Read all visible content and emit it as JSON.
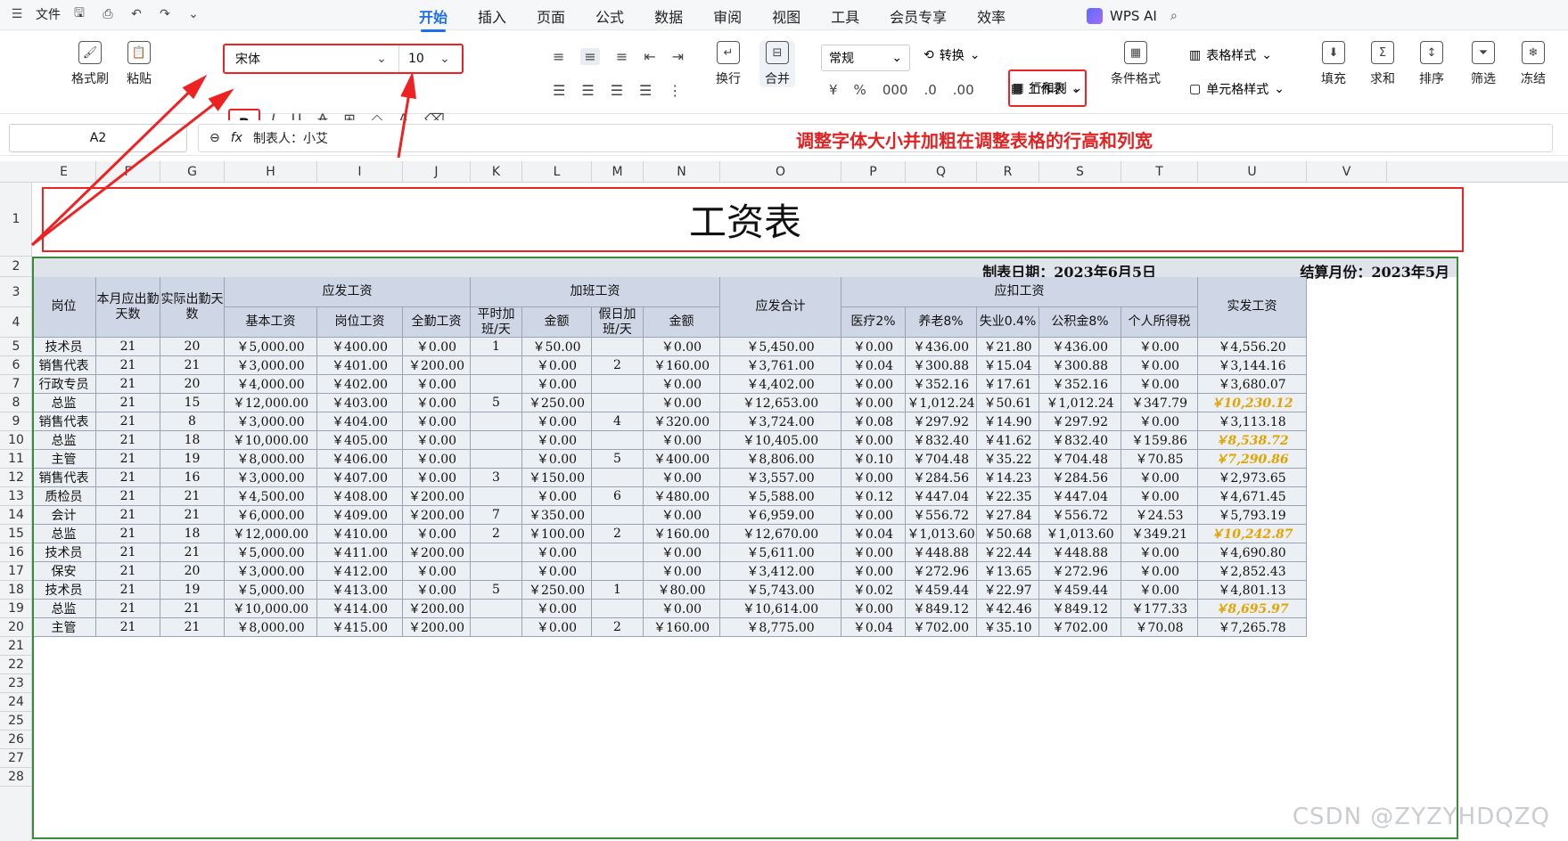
{
  "app": {
    "file_menu": "文件",
    "tabs": [
      "开始",
      "插入",
      "页面",
      "公式",
      "数据",
      "审阅",
      "视图",
      "工具",
      "会员专享",
      "效率"
    ],
    "active_tab": "开始",
    "wps_ai": "WPS AI"
  },
  "ribbon": {
    "format_painter": "格式刷",
    "paste": "粘贴",
    "font_name": "宋体",
    "font_size": "10",
    "wrap": "换行",
    "merge": "合并",
    "number_format": "常规",
    "convert": "转换",
    "row_col": "行和列",
    "table_style": "表格样式",
    "worksheet": "工作表",
    "cond_format": "条件格式",
    "cell_style": "单元格样式",
    "fill": "填充",
    "sum": "求和",
    "sort": "排序",
    "filter": "筛选",
    "freeze": "冻结"
  },
  "formula_bar": {
    "name_box": "A2",
    "fx": "fx",
    "content": "制表人：小艾"
  },
  "annotation": "调整字体大小并加粗在调整表格的行高和列宽",
  "sheet": {
    "columns": [
      "E",
      "F",
      "G",
      "H",
      "I",
      "J",
      "K",
      "L",
      "M",
      "N",
      "O",
      "P",
      "Q",
      "R",
      "S",
      "T",
      "U",
      "V"
    ],
    "rows": [
      "1",
      "2",
      "3",
      "4",
      "5",
      "6",
      "7",
      "8",
      "9",
      "10",
      "11",
      "12",
      "13",
      "14",
      "15",
      "16",
      "17",
      "18",
      "19",
      "20",
      "21",
      "22",
      "23",
      "24",
      "25",
      "26",
      "27",
      "28"
    ],
    "title": "工资表",
    "date_left": "制表日期：2023年6月5日",
    "date_right": "结算月份：2023年5月",
    "headers": {
      "post": "岗位",
      "due_days": "本月应出勤天数",
      "actual_days": "实际出勤天数",
      "payable": "应发工资",
      "base": "基本工资",
      "post_pay": "岗位工资",
      "attendance_pay": "全勤工资",
      "overtime": "加班工资",
      "weekday_ot": "平时加班/天",
      "amount1": "金额",
      "holiday_ot": "假日加班/天",
      "amount2": "金额",
      "total_payable": "应发合计",
      "deductions": "应扣工资",
      "medical": "医疗2%",
      "pension": "养老8%",
      "unemployment": "失业0.4%",
      "housing": "公积金8%",
      "tax": "个人所得税",
      "net": "实发工资"
    },
    "data": [
      [
        "技术员",
        "21",
        "20",
        "￥5,000.00",
        "￥400.00",
        "￥0.00",
        "1",
        "￥50.00",
        "",
        "￥0.00",
        "￥5,450.00",
        "￥0.00",
        "￥436.00",
        "￥21.80",
        "￥436.00",
        "￥0.00",
        "￥4,556.20"
      ],
      [
        "销售代表",
        "21",
        "21",
        "￥3,000.00",
        "￥401.00",
        "￥200.00",
        "",
        "￥0.00",
        "2",
        "￥160.00",
        "￥3,761.00",
        "￥0.04",
        "￥300.88",
        "￥15.04",
        "￥300.88",
        "￥0.00",
        "￥3,144.16"
      ],
      [
        "行政专员",
        "21",
        "20",
        "￥4,000.00",
        "￥402.00",
        "￥0.00",
        "",
        "￥0.00",
        "",
        "￥0.00",
        "￥4,402.00",
        "￥0.00",
        "￥352.16",
        "￥17.61",
        "￥352.16",
        "￥0.00",
        "￥3,680.07"
      ],
      [
        "总监",
        "21",
        "15",
        "￥12,000.00",
        "￥403.00",
        "￥0.00",
        "5",
        "￥250.00",
        "",
        "￥0.00",
        "￥12,653.00",
        "￥0.00",
        "￥1,012.24",
        "￥50.61",
        "￥1,012.24",
        "￥347.79",
        "￥10,230.12"
      ],
      [
        "销售代表",
        "21",
        "8",
        "￥3,000.00",
        "￥404.00",
        "￥0.00",
        "",
        "￥0.00",
        "4",
        "￥320.00",
        "￥3,724.00",
        "￥0.08",
        "￥297.92",
        "￥14.90",
        "￥297.92",
        "￥0.00",
        "￥3,113.18"
      ],
      [
        "总监",
        "21",
        "18",
        "￥10,000.00",
        "￥405.00",
        "￥0.00",
        "",
        "￥0.00",
        "",
        "￥0.00",
        "￥10,405.00",
        "￥0.00",
        "￥832.40",
        "￥41.62",
        "￥832.40",
        "￥159.86",
        "￥8,538.72"
      ],
      [
        "主管",
        "21",
        "19",
        "￥8,000.00",
        "￥406.00",
        "￥0.00",
        "",
        "￥0.00",
        "5",
        "￥400.00",
        "￥8,806.00",
        "￥0.10",
        "￥704.48",
        "￥35.22",
        "￥704.48",
        "￥70.85",
        "￥7,290.86"
      ],
      [
        "销售代表",
        "21",
        "16",
        "￥3,000.00",
        "￥407.00",
        "￥0.00",
        "3",
        "￥150.00",
        "",
        "￥0.00",
        "￥3,557.00",
        "￥0.00",
        "￥284.56",
        "￥14.23",
        "￥284.56",
        "￥0.00",
        "￥2,973.65"
      ],
      [
        "质检员",
        "21",
        "21",
        "￥4,500.00",
        "￥408.00",
        "￥200.00",
        "",
        "￥0.00",
        "6",
        "￥480.00",
        "￥5,588.00",
        "￥0.12",
        "￥447.04",
        "￥22.35",
        "￥447.04",
        "￥0.00",
        "￥4,671.45"
      ],
      [
        "会计",
        "21",
        "21",
        "￥6,000.00",
        "￥409.00",
        "￥200.00",
        "7",
        "￥350.00",
        "",
        "￥0.00",
        "￥6,959.00",
        "￥0.00",
        "￥556.72",
        "￥27.84",
        "￥556.72",
        "￥24.53",
        "￥5,793.19"
      ],
      [
        "总监",
        "21",
        "18",
        "￥12,000.00",
        "￥410.00",
        "￥0.00",
        "2",
        "￥100.00",
        "2",
        "￥160.00",
        "￥12,670.00",
        "￥0.04",
        "￥1,013.60",
        "￥50.68",
        "￥1,013.60",
        "￥349.21",
        "￥10,242.87"
      ],
      [
        "技术员",
        "21",
        "21",
        "￥5,000.00",
        "￥411.00",
        "￥200.00",
        "",
        "￥0.00",
        "",
        "￥0.00",
        "￥5,611.00",
        "￥0.00",
        "￥448.88",
        "￥22.44",
        "￥448.88",
        "￥0.00",
        "￥4,690.80"
      ],
      [
        "保安",
        "21",
        "20",
        "￥3,000.00",
        "￥412.00",
        "￥0.00",
        "",
        "￥0.00",
        "",
        "￥0.00",
        "￥3,412.00",
        "￥0.00",
        "￥272.96",
        "￥13.65",
        "￥272.96",
        "￥0.00",
        "￥2,852.43"
      ],
      [
        "技术员",
        "21",
        "19",
        "￥5,000.00",
        "￥413.00",
        "￥0.00",
        "5",
        "￥250.00",
        "1",
        "￥80.00",
        "￥5,743.00",
        "￥0.02",
        "￥459.44",
        "￥22.97",
        "￥459.44",
        "￥0.00",
        "￥4,801.13"
      ],
      [
        "总监",
        "21",
        "21",
        "￥10,000.00",
        "￥414.00",
        "￥200.00",
        "",
        "￥0.00",
        "",
        "￥0.00",
        "￥10,614.00",
        "￥0.00",
        "￥849.12",
        "￥42.46",
        "￥849.12",
        "￥177.33",
        "￥8,695.97"
      ],
      [
        "主管",
        "21",
        "21",
        "￥8,000.00",
        "￥415.00",
        "￥200.00",
        "",
        "￥0.00",
        "2",
        "￥160.00",
        "￥8,775.00",
        "￥0.04",
        "￥702.00",
        "￥35.10",
        "￥702.00",
        "￥70.08",
        "￥7,265.78"
      ]
    ],
    "highlight_rows": [
      3,
      5,
      6,
      10,
      14
    ],
    "highlight_color": "#e1a400"
  },
  "watermark": "CSDN @ZYZYHDQZQ"
}
